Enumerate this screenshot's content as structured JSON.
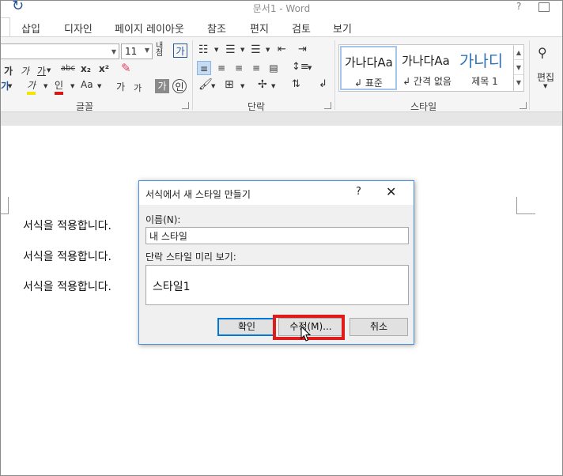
{
  "window": {
    "title": "문서1 - Word",
    "help": "?"
  },
  "tabs": [
    "삽입",
    "디자인",
    "페이지 레이아웃",
    "참조",
    "편지",
    "검토",
    "보기"
  ],
  "ribbon": {
    "font_size": "11",
    "groups": {
      "font": "글꼴",
      "paragraph": "단락",
      "styles": "스타일",
      "editing": "편집"
    },
    "font_row2": [
      "가",
      "가",
      "가",
      "abc",
      "x₂",
      "x²"
    ],
    "font_row3": [
      "가",
      "가",
      "Aa",
      "가",
      "가",
      "가",
      "인"
    ],
    "styles": [
      {
        "sample": "가나다Aa",
        "name": "↲ 표준"
      },
      {
        "sample": "가나다Aa",
        "name": "↲ 간격 없음"
      },
      {
        "sample": "가나디",
        "name": "제목 1"
      }
    ]
  },
  "document": {
    "lines": [
      "서식을 적용합니다.",
      "서식을 적용합니다.",
      "서식을 적용합니다."
    ]
  },
  "dialog": {
    "title": "서식에서 새 스타일 만들기",
    "help": "?",
    "close": "✕",
    "name_label": "이름(N):",
    "name_value": "내 스타일",
    "preview_label": "단락 스타일 미리 보기:",
    "preview_text": "스타일1",
    "ok": "확인",
    "modify": "수정(M)...",
    "cancel": "취소"
  },
  "colors": {
    "accent": "#2b579a",
    "highlight": "#e01b1b",
    "dialog_border": "#4a90d6"
  }
}
